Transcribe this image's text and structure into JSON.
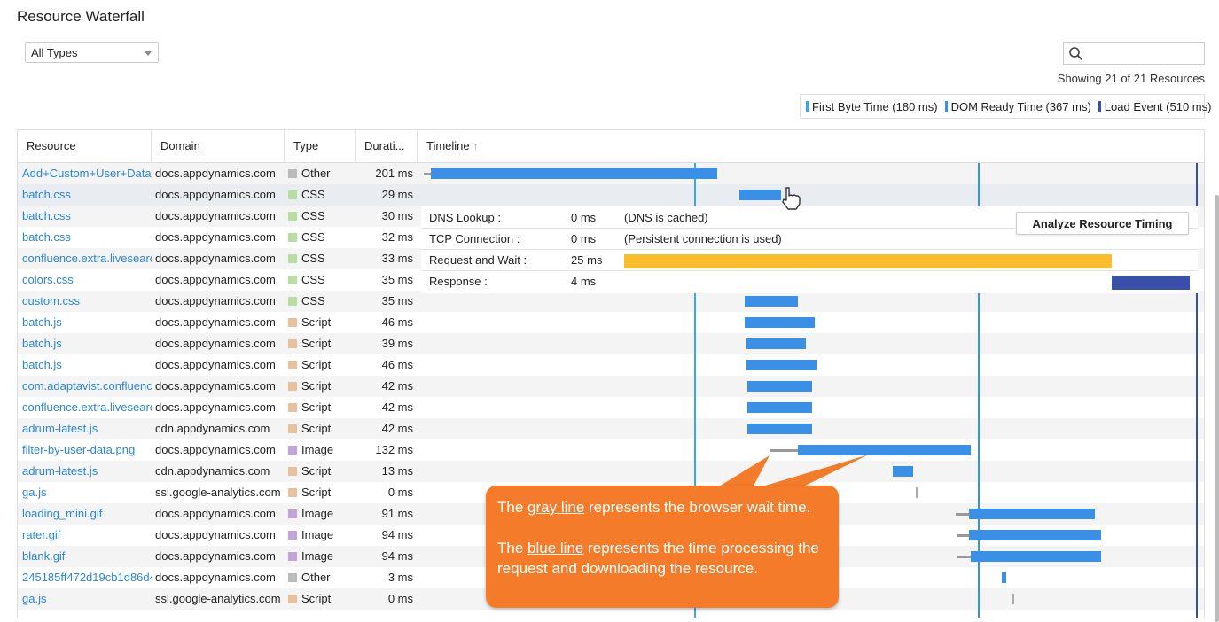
{
  "title": "Resource Waterfall",
  "filter": {
    "selected": "All Types"
  },
  "search": {
    "value": ""
  },
  "showing": "Showing 21 of 21 Resources",
  "legend": [
    {
      "label": "First Byte Time (180 ms)",
      "color": "#3aa6e6"
    },
    {
      "label": "DOM Ready Time (367 ms)",
      "color": "#3a8fe6"
    },
    {
      "label": "Load Event (510 ms)",
      "color": "#3a4fa8"
    }
  ],
  "columns": {
    "resource": "Resource",
    "domain": "Domain",
    "type": "Type",
    "duration": "Durati...",
    "timeline": "Timeline"
  },
  "colors": {
    "link": "#2a86d8",
    "bar": "#3a8fe6",
    "wait": "#999999",
    "request": "#fbbd2c",
    "response": "#3a4fa8",
    "callout": "#f47b2a"
  },
  "type_colors": {
    "Other": "#bbbbbb",
    "CSS": "#b6dea0",
    "Script": "#e8c09a",
    "Image": "#c2a2d8"
  },
  "rows": [
    {
      "resource": "Add+Custom+User+Data+",
      "domain": "docs.appdynamics.com",
      "type": "Other",
      "duration": "201 ms"
    },
    {
      "resource": "batch.css",
      "domain": "docs.appdynamics.com",
      "type": "CSS",
      "duration": "29 ms"
    },
    {
      "resource": "batch.css",
      "domain": "docs.appdynamics.com",
      "type": "CSS",
      "duration": "30 ms"
    },
    {
      "resource": "batch.css",
      "domain": "docs.appdynamics.com",
      "type": "CSS",
      "duration": "32 ms"
    },
    {
      "resource": "confluence.extra.livesearc",
      "domain": "docs.appdynamics.com",
      "type": "CSS",
      "duration": "33 ms"
    },
    {
      "resource": "colors.css",
      "domain": "docs.appdynamics.com",
      "type": "CSS",
      "duration": "35 ms"
    },
    {
      "resource": "custom.css",
      "domain": "docs.appdynamics.com",
      "type": "CSS",
      "duration": "35 ms"
    },
    {
      "resource": "batch.js",
      "domain": "docs.appdynamics.com",
      "type": "Script",
      "duration": "46 ms"
    },
    {
      "resource": "batch.js",
      "domain": "docs.appdynamics.com",
      "type": "Script",
      "duration": "39 ms"
    },
    {
      "resource": "batch.js",
      "domain": "docs.appdynamics.com",
      "type": "Script",
      "duration": "46 ms"
    },
    {
      "resource": "com.adaptavist.confluenc",
      "domain": "docs.appdynamics.com",
      "type": "Script",
      "duration": "42 ms"
    },
    {
      "resource": "confluence.extra.livesearc",
      "domain": "docs.appdynamics.com",
      "type": "Script",
      "duration": "42 ms"
    },
    {
      "resource": "adrum-latest.js",
      "domain": "cdn.appdynamics.com",
      "type": "Script",
      "duration": "42 ms"
    },
    {
      "resource": "filter-by-user-data.png",
      "domain": "docs.appdynamics.com",
      "type": "Image",
      "duration": "132 ms"
    },
    {
      "resource": "adrum-latest.js",
      "domain": "cdn.appdynamics.com",
      "type": "Script",
      "duration": "13 ms"
    },
    {
      "resource": "ga.js",
      "domain": "ssl.google-analytics.com",
      "type": "Script",
      "duration": "0 ms"
    },
    {
      "resource": "loading_mini.gif",
      "domain": "docs.appdynamics.com",
      "type": "Image",
      "duration": "91 ms"
    },
    {
      "resource": "rater.gif",
      "domain": "docs.appdynamics.com",
      "type": "Image",
      "duration": "94 ms"
    },
    {
      "resource": "blank.gif",
      "domain": "docs.appdynamics.com",
      "type": "Image",
      "duration": "94 ms"
    },
    {
      "resource": "245185ff472d19cb1d86d4",
      "domain": "docs.appdynamics.com",
      "type": "Other",
      "duration": "3 ms"
    },
    {
      "resource": "ga.js",
      "domain": "ssl.google-analytics.com",
      "type": "Script",
      "duration": "0 ms"
    }
  ],
  "detail": [
    {
      "label": "DNS Lookup :",
      "value": "0 ms",
      "note": "(DNS is cached)"
    },
    {
      "label": "TCP Connection :",
      "value": "0 ms",
      "note": "(Persistent connection is used)"
    },
    {
      "label": "Request and Wait :",
      "value": "25 ms",
      "note": ""
    },
    {
      "label": "Response :",
      "value": "4 ms",
      "note": ""
    }
  ],
  "analyze_button": "Analyze Resource Timing",
  "callout": {
    "p1_pre": "The ",
    "p1_link": "gray line",
    "p1_post": " represents the browser wait time.",
    "p2_pre": "The ",
    "p2_link": "blue line",
    "p2_post": " represents the time processing the request and downloading the resource."
  }
}
